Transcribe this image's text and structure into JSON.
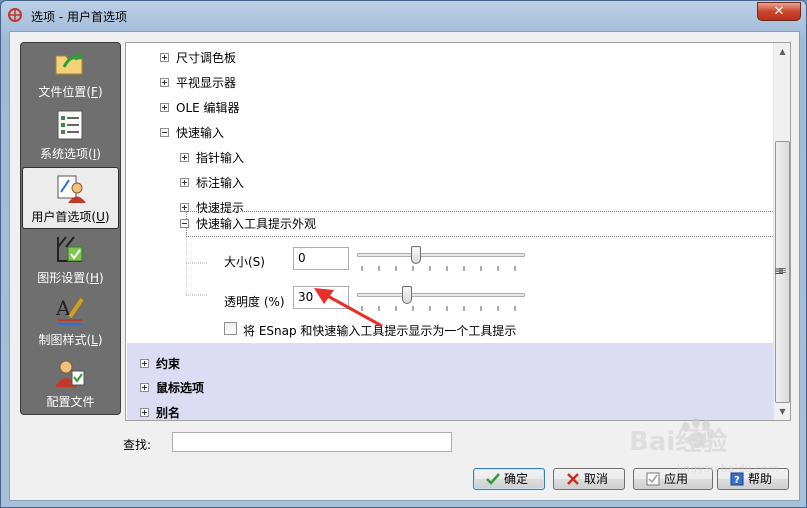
{
  "window": {
    "title": "选项 - 用户首选项",
    "close_glyph": "✕"
  },
  "nav": {
    "items": [
      {
        "label": "文件位置",
        "key": "F",
        "icon": "folder-icon"
      },
      {
        "label": "系统选项",
        "key": "I",
        "icon": "checklist-icon"
      },
      {
        "label": "用户首选项",
        "key": "U",
        "icon": "user-preferences-icon",
        "active": true
      },
      {
        "label": "图形设置",
        "key": "H",
        "icon": "graphics-icon"
      },
      {
        "label": "制图样式",
        "key": "L",
        "icon": "drafting-style-icon"
      },
      {
        "label": "配置文件",
        "key": "",
        "icon": "profile-icon"
      }
    ]
  },
  "tree": {
    "nodes": {
      "size_palette": "尺寸调色板",
      "plan_view": "平视显示器",
      "ole_editor": "OLE 编辑器",
      "dynamic_input": "快速输入",
      "pointer_input": "指针输入",
      "dimension_input": "标注输入",
      "dynamic_prompts": "快速提示",
      "tooltip_appearance": "快速输入工具提示外观"
    },
    "size_label": "大小(S)",
    "size_value": "0",
    "size_slider_fraction": 0.35,
    "transparency_label": "透明度 (%)",
    "transparency_value": "30",
    "transparency_slider_fraction": 0.3,
    "checkbox_label": "将 ESnap 和快速输入工具提示显示为一个工具提示",
    "checkbox_checked": false,
    "groups": {
      "constraints": "约束",
      "mouse_options": "鼠标选项",
      "aliases": "别名"
    },
    "scroll_grip": "≡"
  },
  "search": {
    "label": "查找:",
    "value": ""
  },
  "buttons": {
    "ok": "确定",
    "cancel": "取消",
    "apply": "应用",
    "help": "帮助"
  },
  "watermark": {
    "text": "Bai经验",
    "sub": "jingyan.baidu.com"
  },
  "colors": {
    "nav_bg": "#6f6f6f",
    "group_band": "#dcdcf4",
    "annotation_arrow": "#e8302a"
  }
}
